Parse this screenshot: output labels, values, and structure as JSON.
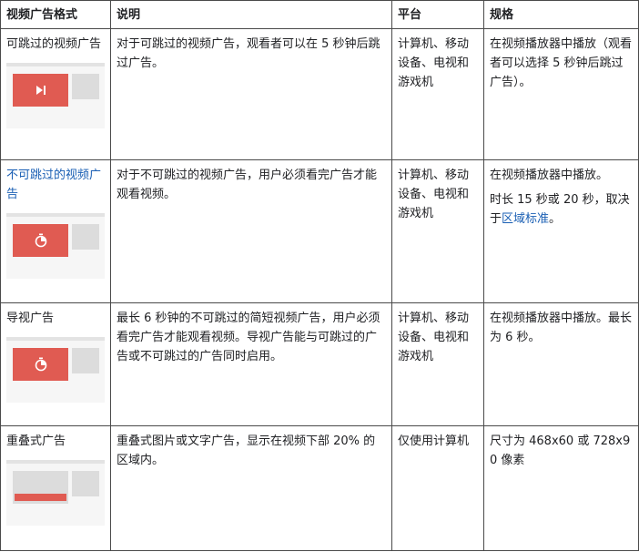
{
  "table": {
    "headers": [
      "视频广告格式",
      "说明",
      "平台",
      "规格"
    ],
    "rows": [
      {
        "format": "可跳过的视频广告",
        "thumb_icon": "skip-icon",
        "description": "对于可跳过的视频广告，观看者可以在 5 秒钟后跳过广告。",
        "platform": "计算机、移动设备、电视和游戏机",
        "spec": "在视频播放器中播放（观看者可以选择 5 秒钟后跳过广告）。"
      },
      {
        "format": "不可跳过的视频广告",
        "thumb_icon": "timer-icon",
        "description": "对于不可跳过的视频广告，用户必须看完广告才能观看视频。",
        "platform": "计算机、移动设备、电视和游戏机",
        "spec": "在视频播放器中播放。",
        "spec2_prefix": "时长 15 秒或 20 秒，取决于",
        "spec2_link": "区域标准",
        "spec2_suffix": "。"
      },
      {
        "format": "导视广告",
        "thumb_icon": "timer-icon",
        "description": "最长 6 秒钟的不可跳过的简短视频广告，用户必须看完广告才能观看视频。导视广告能与可跳过的广告或不可跳过的广告同时启用。",
        "platform": "计算机、移动设备、电视和游戏机",
        "spec": "在视频播放器中播放。最长为 6 秒。"
      },
      {
        "format": "重叠式广告",
        "thumb_icon": "overlay-bar-icon",
        "description": "重叠式图片或文字广告，显示在视频下部 20% 的区域内。",
        "platform": "仅使用计算机",
        "spec": "尺寸为 468x60 或 728x90 像素"
      }
    ]
  },
  "colors": {
    "link": "#1a5fb4",
    "thumb_red": "#e05b52",
    "thumb_gray": "#dcdcdc"
  }
}
